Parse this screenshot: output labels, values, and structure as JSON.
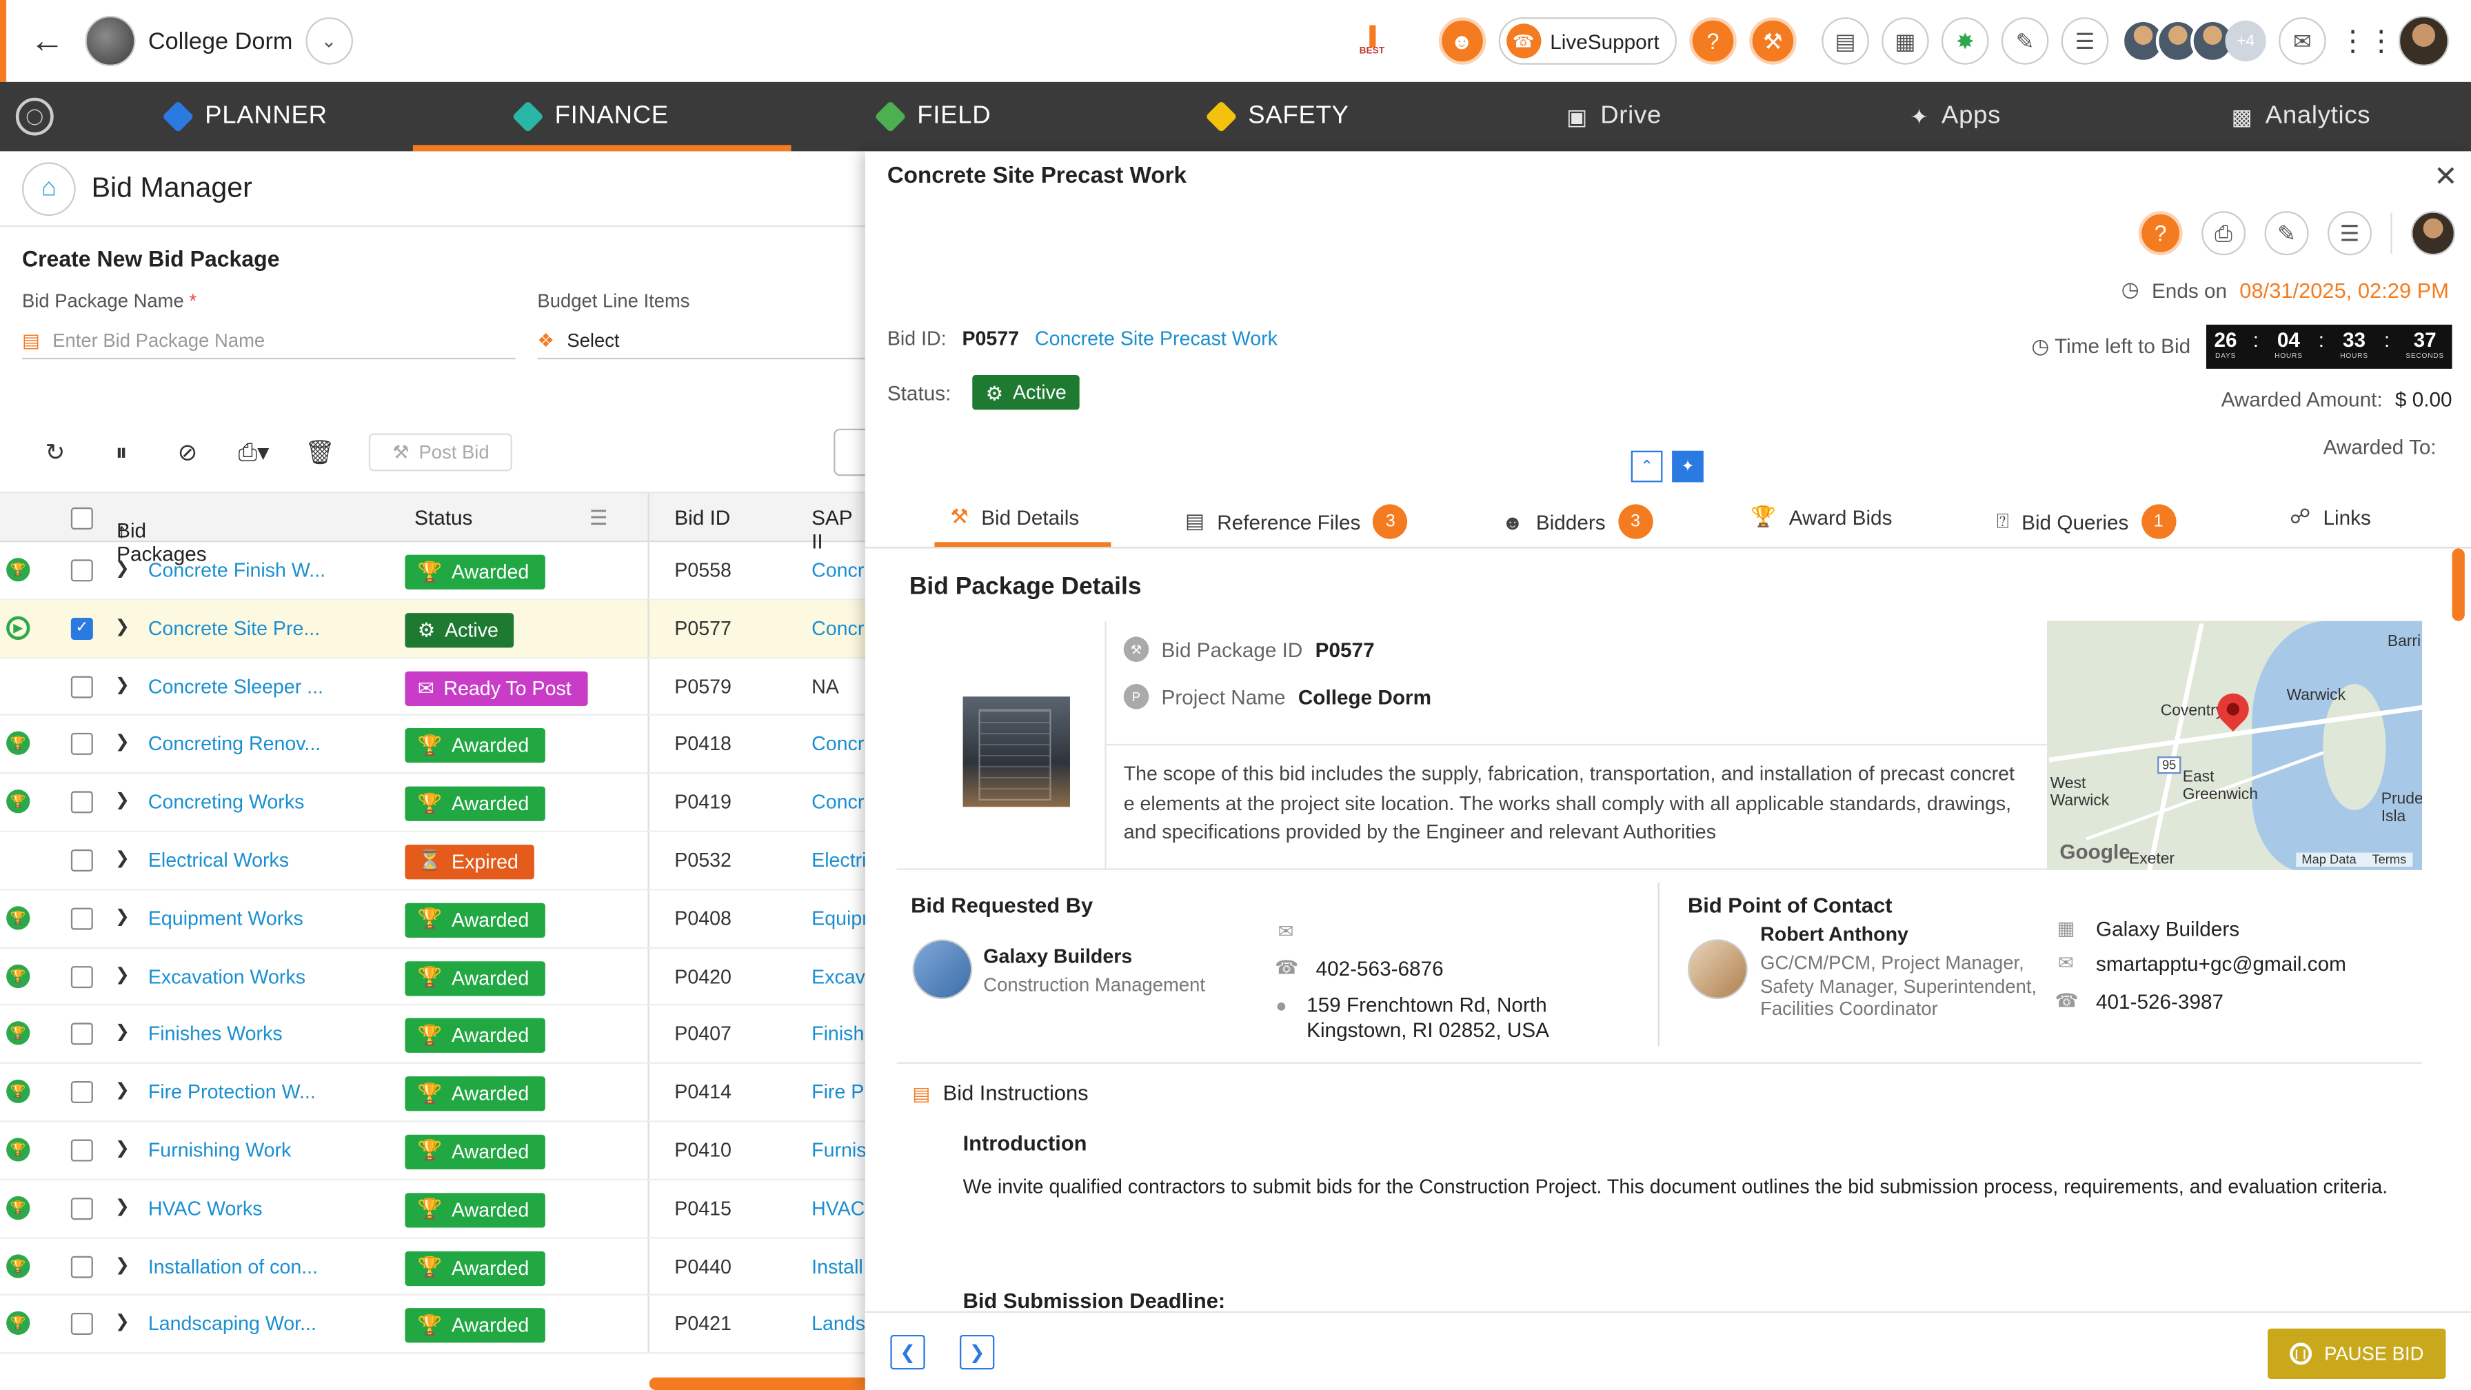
{
  "topbar": {
    "project_name": "College Dorm",
    "logo_text": "BEST",
    "live_support": "LiveSupport",
    "avatar_more": "+4"
  },
  "nav": {
    "items": [
      {
        "label": "PLANNER",
        "color": "#2a7ae2"
      },
      {
        "label": "FINANCE",
        "color": "#29b6a6"
      },
      {
        "label": "FIELD",
        "color": "#4caf50"
      },
      {
        "label": "SAFETY",
        "color": "#f4c20d"
      },
      {
        "label": "Drive",
        "color": "#cccccc"
      },
      {
        "label": "Apps",
        "color": "#cccccc"
      },
      {
        "label": "Analytics",
        "color": "#cccccc"
      }
    ],
    "active": "FINANCE"
  },
  "left": {
    "title": "Bid Manager",
    "create_title": "Create New Bid Package",
    "bid_package_name_label": "Bid Package Name",
    "required_mark": "*",
    "bid_package_name_placeholder": "Enter Bid Package Name",
    "budget_label": "Budget Line Items",
    "budget_value": "Select",
    "post_bid": "Post Bid",
    "columns": {
      "packages": "Bid Packages",
      "status": "Status",
      "bid_id": "Bid ID",
      "sap": "SAP II"
    },
    "rows": [
      {
        "name": "Concrete Finish W...",
        "status": "Awarded",
        "bid_id": "P0558",
        "sap": "Concr"
      },
      {
        "name": "Concrete Site Pre...",
        "status": "Active",
        "bid_id": "P0577",
        "sap": "Concr"
      },
      {
        "name": "Concrete Sleeper ...",
        "status": "Ready To Post",
        "bid_id": "P0579",
        "sap": "NA"
      },
      {
        "name": "Concreting Renov...",
        "status": "Awarded",
        "bid_id": "P0418",
        "sap": "Concr"
      },
      {
        "name": "Concreting Works",
        "status": "Awarded",
        "bid_id": "P0419",
        "sap": "Concr"
      },
      {
        "name": "Electrical Works",
        "status": "Expired",
        "bid_id": "P0532",
        "sap": "Electri"
      },
      {
        "name": "Equipment Works",
        "status": "Awarded",
        "bid_id": "P0408",
        "sap": "Equipr"
      },
      {
        "name": "Excavation Works",
        "status": "Awarded",
        "bid_id": "P0420",
        "sap": "Excav"
      },
      {
        "name": "Finishes Works",
        "status": "Awarded",
        "bid_id": "P0407",
        "sap": "Finish"
      },
      {
        "name": "Fire Protection W...",
        "status": "Awarded",
        "bid_id": "P0414",
        "sap": "Fire Pr"
      },
      {
        "name": "Furnishing Work",
        "status": "Awarded",
        "bid_id": "P0410",
        "sap": "Furnis"
      },
      {
        "name": "HVAC Works",
        "status": "Awarded",
        "bid_id": "P0415",
        "sap": "HVAC"
      },
      {
        "name": "Installation of con...",
        "status": "Awarded",
        "bid_id": "P0440",
        "sap": "Install"
      },
      {
        "name": "Landscaping Wor...",
        "status": "Awarded",
        "bid_id": "P0421",
        "sap": "Lands"
      }
    ]
  },
  "panel": {
    "title": "Concrete Site Precast Work",
    "ends_label": "Ends on",
    "ends_date": "08/31/2025, 02:29 PM",
    "bid_id_label": "Bid ID:",
    "bid_id": "P0577",
    "bid_name": "Concrete Site Precast Work",
    "time_left_label": "Time left to Bid",
    "timer": {
      "days": "26",
      "hours": "04",
      "minutes": "33",
      "seconds": "37",
      "days_l": "DAYS",
      "hours_l": "HOURS",
      "minutes_l": "HOURS",
      "seconds_l": "SECONDS"
    },
    "status_label": "Status:",
    "status": "Active",
    "awarded_amount_label": "Awarded Amount:",
    "awarded_amount": "$ 0.00",
    "awarded_to_label": "Awarded To:",
    "tabs": [
      {
        "label": "Bid Details",
        "count": ""
      },
      {
        "label": "Reference Files",
        "count": "3"
      },
      {
        "label": "Bidders",
        "count": "3"
      },
      {
        "label": "Award Bids",
        "count": ""
      },
      {
        "label": "Bid Queries",
        "count": "1"
      },
      {
        "label": "Links",
        "count": ""
      }
    ],
    "details": {
      "section_title": "Bid Package Details",
      "pkg_id_label": "Bid Package ID",
      "pkg_id": "P0577",
      "project_label": "Project Name",
      "project": "College Dorm",
      "description": "The scope of this bid includes the supply, fabrication, transportation, and installation of precast concrete elements at the project site location. The works shall comply with all applicable standards, drawings, and specifications provided by the Engineer and relevant Authorities",
      "map_labels": [
        "Coventry",
        "Warwick",
        "West Warwick",
        "East Greenwich",
        "Exeter",
        "Barri",
        "Prude Isla",
        "95",
        "Map Data",
        "Terms",
        "Google"
      ]
    },
    "requested_by": {
      "heading": "Bid Requested By",
      "company": "Galaxy Builders",
      "company_type": "Construction Management",
      "email": "",
      "phone": "402-563-6876",
      "address": "159 Frenchtown Rd, North Kingstown, RI 02852, USA"
    },
    "point_of_contact": {
      "heading": "Bid Point of Contact",
      "name": "Robert   Anthony",
      "roles": "GC/CM/PCM, Project Manager, Safety Manager, Superintendent, Facilities Coordinator",
      "company": "Galaxy Builders",
      "email": "smartapptu+gc@gmail.com",
      "phone": "401-526-3987"
    },
    "instructions": {
      "title": "Bid Instructions",
      "intro_heading": "Introduction",
      "intro_text": "We invite qualified contractors to submit bids for the Construction Project. This document outlines the bid submission process, requirements, and evaluation criteria.",
      "deadline_heading": "Bid Submission Deadline:"
    },
    "pause_bid": "PAUSE BID"
  }
}
